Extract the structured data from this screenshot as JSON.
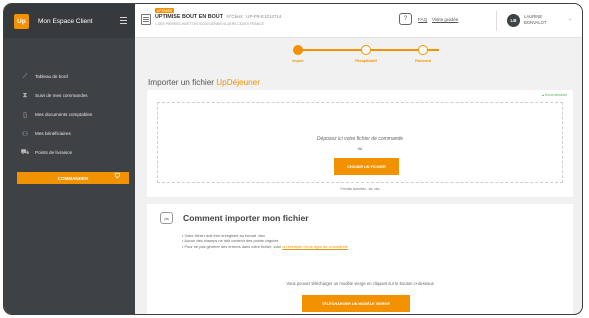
{
  "brand": {
    "logo": "Up",
    "title": "Mon Espace Client"
  },
  "sidebar": {
    "items": [
      {
        "label": "Tableau de bord",
        "icon": "chart-line-icon"
      },
      {
        "label": "Suivi de mes commandes",
        "icon": "hourglass-icon"
      },
      {
        "label": "Mes documents comptables",
        "icon": "document-icon"
      },
      {
        "label": "Mes bénéficiaires",
        "icon": "users-icon"
      },
      {
        "label": "Points de livraison",
        "icon": "truck-icon"
      }
    ],
    "commander_label": "COMMANDER"
  },
  "header": {
    "badge": "UPTIMISE",
    "company": "UPTIMISE BOUT EN BOUT",
    "client_no": "N°Client : UP-FR-E1014714",
    "address": "1 DES PIERRES INVETTES 92230 GENNEVILLIERS CEDEX FRANCE",
    "help_glyph": "?",
    "faq": "FAQ",
    "guide": "Visite guidée",
    "avatar_initials": "LB",
    "user_first": "LAURINE",
    "user_last": "BONVALOT"
  },
  "stepper": {
    "steps": [
      {
        "label": "Import",
        "state": "active"
      },
      {
        "label": "Récapitulatif",
        "state": "todo"
      },
      {
        "label": "Paiement",
        "state": "todo"
      }
    ]
  },
  "page": {
    "title_prefix": "Importer un fichier ",
    "title_highlight": "UpDéjeuner"
  },
  "upload": {
    "secure": "Envoi sécurisé",
    "drop_text": "Déposez ici votre fichier de commande",
    "or_text": "ou",
    "choose_button": "CHOISIR UN FICHIER",
    "formats": "Formats autorisés : xls, xlsx"
  },
  "help": {
    "icon_text": "xls",
    "title": "Comment importer mon fichier",
    "bullets": [
      "Votre fichier doit être enregistré au format .xlsx",
      "Aucun des champs ne doit contenir des points virgules",
      "Pour ne pas générer des erreurs dans votre fichier, voici "
    ],
    "bullet_link": "un exemple d'une ligne de commande",
    "template_text": "Vous pouvez télécharger un modèle vierge en cliquant sur le bouton ci-dessous",
    "download_button": "TÉLÉCHARGER UN MODÈLE VIERGE"
  },
  "colors": {
    "accent": "#f39200",
    "sidebar": "#3f4244"
  }
}
